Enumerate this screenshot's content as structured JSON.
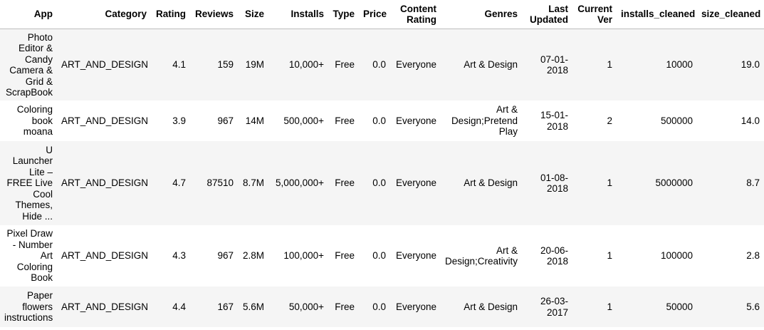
{
  "table": {
    "columns": [
      "App",
      "Category",
      "Rating",
      "Reviews",
      "Size",
      "Installs",
      "Type",
      "Price",
      "Content Rating",
      "Genres",
      "Last Updated",
      "Current Ver",
      "installs_cleaned",
      "size_cleaned"
    ],
    "rows": [
      [
        "Photo Editor & Candy Camera & Grid & ScrapBook",
        "ART_AND_DESIGN",
        "4.1",
        "159",
        "19M",
        "10,000+",
        "Free",
        "0.0",
        "Everyone",
        "Art & Design",
        "07-01-2018",
        "1",
        "10000",
        "19.0"
      ],
      [
        "Coloring book moana",
        "ART_AND_DESIGN",
        "3.9",
        "967",
        "14M",
        "500,000+",
        "Free",
        "0.0",
        "Everyone",
        "Art & Design;Pretend Play",
        "15-01-2018",
        "2",
        "500000",
        "14.0"
      ],
      [
        "U Launcher Lite – FREE Live Cool Themes, Hide ...",
        "ART_AND_DESIGN",
        "4.7",
        "87510",
        "8.7M",
        "5,000,000+",
        "Free",
        "0.0",
        "Everyone",
        "Art & Design",
        "01-08-2018",
        "1",
        "5000000",
        "8.7"
      ],
      [
        "Pixel Draw - Number Art Coloring Book",
        "ART_AND_DESIGN",
        "4.3",
        "967",
        "2.8M",
        "100,000+",
        "Free",
        "0.0",
        "Everyone",
        "Art & Design;Creativity",
        "20-06-2018",
        "1",
        "100000",
        "2.8"
      ],
      [
        "Paper flowers instructions",
        "ART_AND_DESIGN",
        "4.4",
        "167",
        "5.6M",
        "50,000+",
        "Free",
        "0.0",
        "Everyone",
        "Art & Design",
        "26-03-2017",
        "1",
        "50000",
        "5.6"
      ]
    ]
  }
}
